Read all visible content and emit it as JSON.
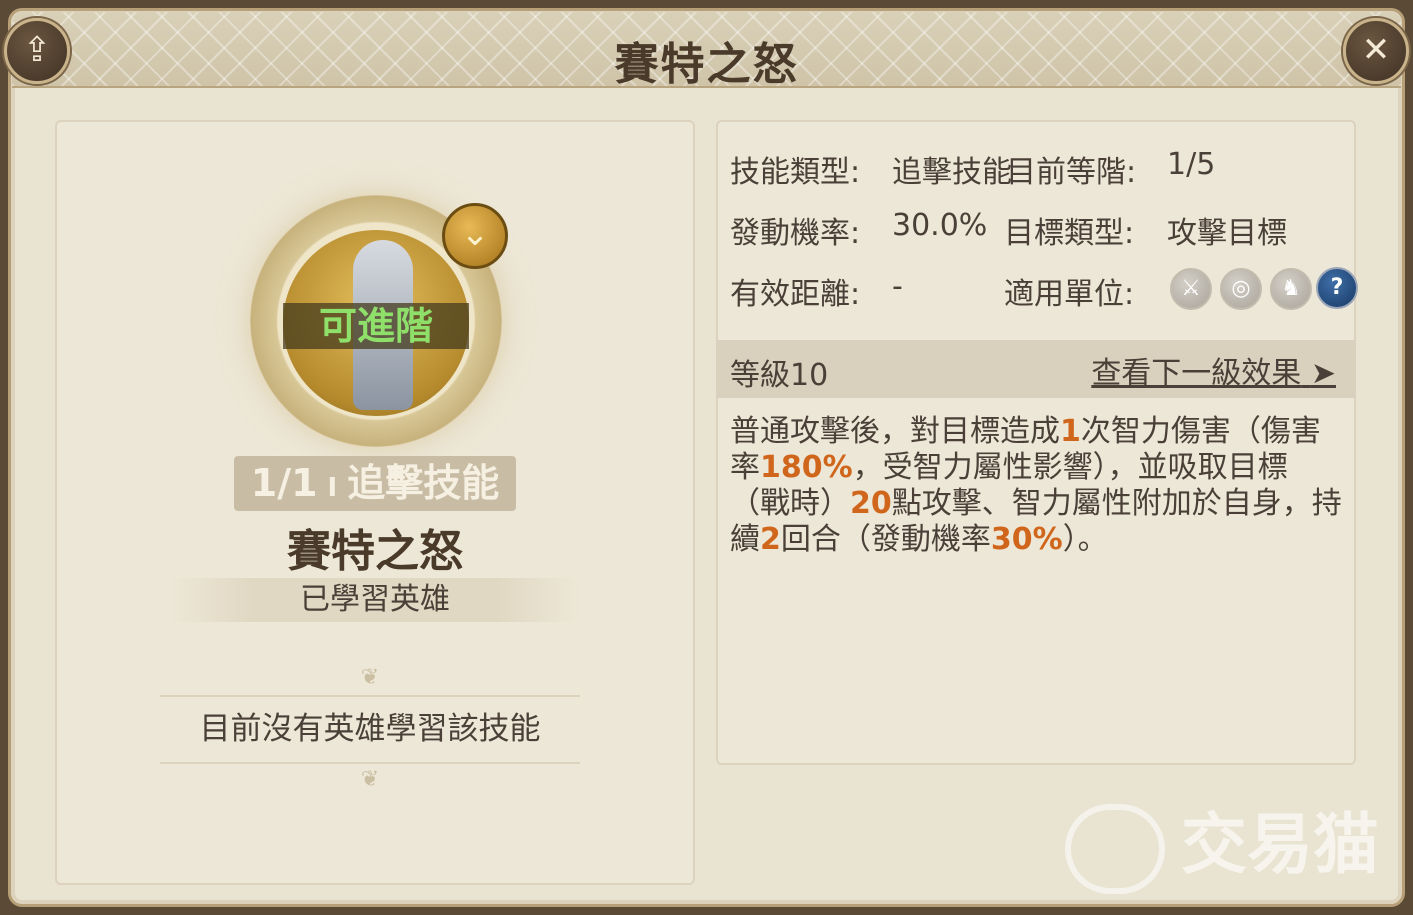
{
  "dialog": {
    "title": "賽特之怒"
  },
  "left": {
    "upgrade_label": "可進階",
    "tag_count": "1/1",
    "tag_sep": "I",
    "tag_type": "追擊技能",
    "skill_name": "賽特之怒",
    "learned_label": "已學習英雄",
    "no_hero_text": "目前沒有英雄學習該技能"
  },
  "info": {
    "type_label": "技能類型:",
    "type_value": "追擊技能",
    "stage_label": "目前等階:",
    "stage_value": "1/5",
    "chance_label": "發動機率:",
    "chance_value": "30.0%",
    "target_label": "目標類型:",
    "target_value": "攻擊目標",
    "range_label": "有效距離:",
    "range_value": "-",
    "unit_label": "適用單位:",
    "unit_icons": [
      "sword-icon",
      "target-icon",
      "horse-icon",
      "question-icon"
    ],
    "question_glyph": "?"
  },
  "level": {
    "label": "等級10",
    "next_link": "查看下一級效果"
  },
  "description": {
    "p1": "普通攻擊後，對目標造成",
    "n1": "1",
    "p2": "次智力傷害（傷害率",
    "n2": "180%",
    "p3": "，受智力屬性影響），並吸取目標（戰時）",
    "n3": "20",
    "p4": "點攻擊、智力屬性附加於自身，持續",
    "n4": "2",
    "p5": "回合（發動機率",
    "n5": "30%",
    "p6": "）。"
  },
  "watermark": {
    "text": "交易猫"
  },
  "colors": {
    "highlight": "#d0661b",
    "upgrade_green": "#8fe06a",
    "parchment": "#e9e3d2"
  }
}
